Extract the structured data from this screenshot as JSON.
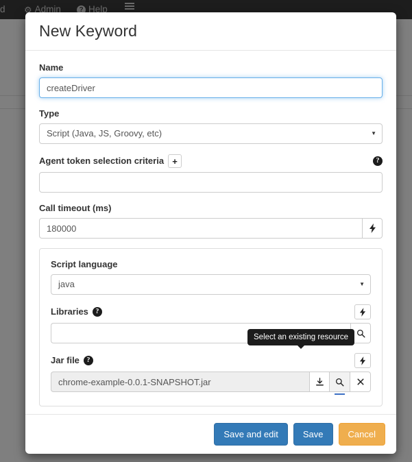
{
  "background": {
    "navbar": {
      "truncated_item": "d",
      "items": [
        {
          "label": "Admin",
          "icon": "gear-icon"
        },
        {
          "label": "Help",
          "icon": "help-circle-icon"
        },
        {
          "label": "",
          "icon": "hamburger-menu-icon"
        }
      ]
    }
  },
  "modal": {
    "title": "New Keyword",
    "fields": {
      "name": {
        "label": "Name",
        "value": "createDriver",
        "placeholder": ""
      },
      "type": {
        "label": "Type",
        "value": "Script (Java, JS, Groovy, etc)",
        "options": [
          "Script (Java, JS, Groovy, etc)"
        ]
      },
      "agent_token": {
        "label": "Agent token selection criteria",
        "add_button": "+",
        "help_icon": "help-circle-icon",
        "value": "",
        "placeholder": ""
      },
      "call_timeout": {
        "label": "Call timeout (ms)",
        "value": "180000",
        "placeholder": "",
        "bolt_button": "bolt-icon"
      }
    },
    "panel": {
      "script_language": {
        "label": "Script language",
        "value": "java",
        "options": [
          "java"
        ]
      },
      "libraries": {
        "label": "Libraries",
        "help_icon": "help-circle-icon",
        "bolt_button": "bolt-icon",
        "value": "",
        "placeholder": "",
        "search_button": "search-icon"
      },
      "jar_file": {
        "label": "Jar file",
        "help_icon": "help-circle-icon",
        "value": "chrome-example-0.0.1-SNAPSHOT.jar",
        "disabled": true,
        "buttons": [
          {
            "name": "download-icon",
            "glyph": "download"
          },
          {
            "name": "search-icon",
            "glyph": "search"
          },
          {
            "name": "clear-icon",
            "glyph": "close"
          }
        ]
      }
    },
    "tooltip": {
      "text": "Select an existing resource"
    },
    "footer": {
      "save_and_edit_label": "Save and edit",
      "save_label": "Save",
      "cancel_label": "Cancel"
    }
  },
  "colors": {
    "primary": "#337ab7",
    "warning": "#efae4e",
    "focus_ring": "#66afe9",
    "tooltip_bg": "#1c1c1c",
    "active_underline": "#3b6fc4"
  }
}
